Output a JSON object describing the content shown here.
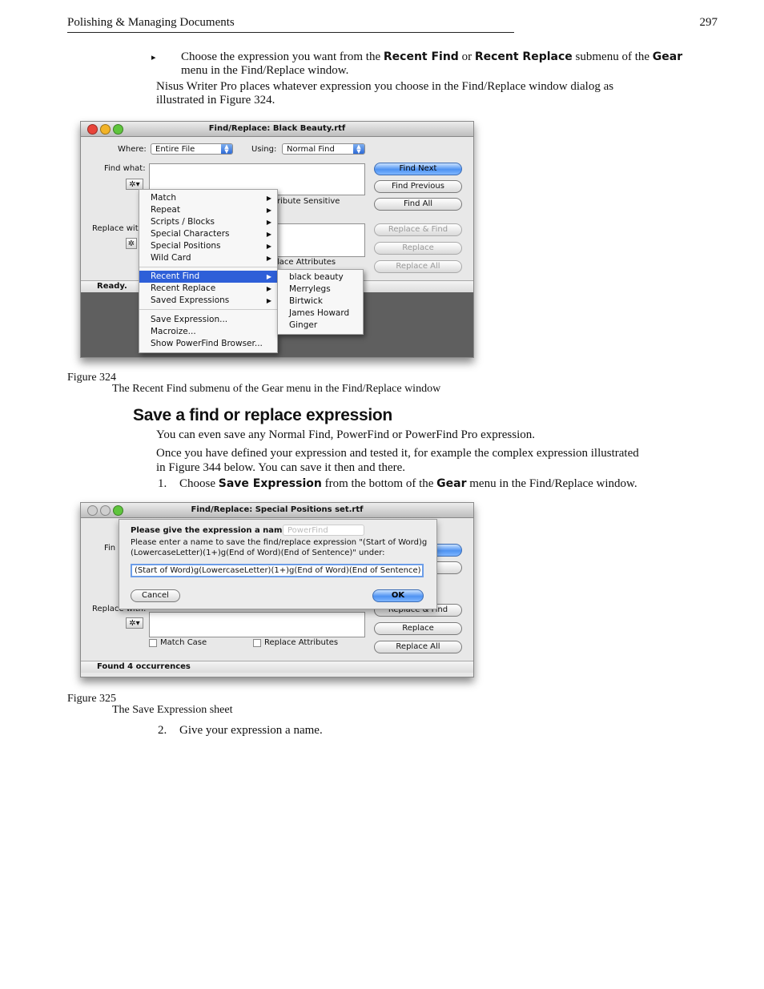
{
  "header": {
    "title": "Polishing & Managing Documents",
    "page_number": "297"
  },
  "bullet": {
    "marker": "▸",
    "part1": "Choose the expression you want from the ",
    "bold1": "Recent Find",
    "part2": " or ",
    "bold2": "Recent Replace",
    "part3": " submenu of the ",
    "bold3": "Gear",
    "line2": "menu in the Find/Replace window."
  },
  "para1": {
    "line1": "Nisus Writer Pro places whatever expression you choose in the Find/Replace window dialog as",
    "line2": "illustrated in Figure 324."
  },
  "figure324": {
    "window_title": "Find/Replace: Black Beauty.rtf",
    "where_label": "Where:",
    "where_value": "Entire File",
    "using_label": "Using:",
    "using_value": "Normal Find",
    "find_what_label": "Find what:",
    "replace_with_label": "Replace wit",
    "gear_symbol": "✲▾",
    "obscured_text_1": "ribute Sensitive",
    "obscured_text_2": "lace Attributes",
    "buttons": {
      "find_next": "Find Next",
      "find_previous": "Find Previous",
      "find_all": "Find All",
      "replace_find": "Replace & Find",
      "replace": "Replace",
      "replace_all": "Replace All"
    },
    "status": "Ready.",
    "menu_items": [
      "Match",
      "Repeat",
      "Scripts / Blocks",
      "Special Characters",
      "Special Positions",
      "Wild Card",
      "Recent Find",
      "Recent Replace",
      "Saved Expressions",
      "Save Expression...",
      "Macroize...",
      "Show PowerFind Browser..."
    ],
    "submenu_items": [
      "black beauty",
      "Merrylegs",
      "Birtwick",
      "James Howard",
      "Ginger"
    ],
    "caption_number": "Figure 324",
    "caption_text": "The Recent Find submenu of the Gear menu in the Find/Replace window"
  },
  "section": {
    "heading": "Save a find or replace expression",
    "para1": "You can even save any Normal Find, PowerFind or PowerFind Pro expression.",
    "para2_line1": "Once you have defined your expression and tested it, for example the complex expression illustrated",
    "para2_line2": "in Figure 344 below. You can save it then and there.",
    "step1_num": "1.",
    "step1_part1": "Choose ",
    "step1_bold1": "Save Expression",
    "step1_part2": " from the bottom of the ",
    "step1_bold2": "Gear",
    "step1_part3": " menu in the Find/Replace window."
  },
  "figure325": {
    "window_title": "Find/Replace: Special Positions set.rtf",
    "sheet_title": "Please give the expression a name.",
    "sheet_msg_line1": "Please enter a name to save the find/replace expression \"(Start of Word)g",
    "sheet_msg_line2": "(LowercaseLetter)(1+)g(End of Word)(End of Sentence)\" under:",
    "sheet_input_value": "(Start of Word)g(LowercaseLetter)(1+)g(End of Word)(End of Sentence)",
    "sheet_cancel": "Cancel",
    "sheet_ok": "OK",
    "bg_using_value": "PowerFind",
    "find_label_partial": "Fin",
    "replace_label_partial": "Replace with:",
    "gear_symbol": "✲▾",
    "match_case": "Match Case",
    "replace_attributes": "Replace Attributes",
    "buttons": {
      "replace_find": "Replace & Find",
      "replace": "Replace",
      "replace_all": "Replace All"
    },
    "status": "Found 4 occurrences",
    "caption_number": "Figure 325",
    "caption_text": "The Save Expression sheet"
  },
  "step2": {
    "num": "2.",
    "text": "Give your expression a name."
  }
}
